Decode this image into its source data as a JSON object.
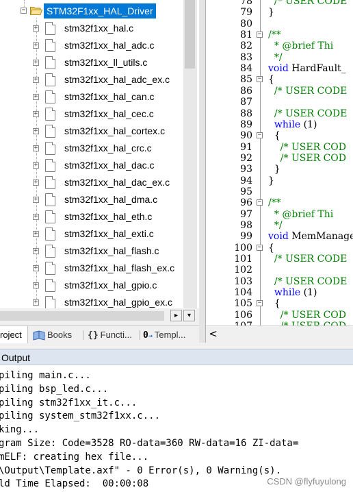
{
  "project_tree": {
    "folder": {
      "label": "STM32F1xx_HAL_Driver",
      "expander": "−"
    },
    "files": [
      "stm32f1xx_hal.c",
      "stm32f1xx_hal_adc.c",
      "stm32f1xx_ll_utils.c",
      "stm32f1xx_hal_adc_ex.c",
      "stm32f1xx_hal_can.c",
      "stm32f1xx_hal_cec.c",
      "stm32f1xx_hal_cortex.c",
      "stm32f1xx_hal_crc.c",
      "stm32f1xx_hal_dac.c",
      "stm32f1xx_hal_dac_ex.c",
      "stm32f1xx_hal_dma.c",
      "stm32f1xx_hal_eth.c",
      "stm32f1xx_hal_exti.c",
      "stm32f1xx_hal_flash.c",
      "stm32f1xx_hal_flash_ex.c",
      "stm32f1xx_hal_gpio.c",
      "stm32f1xx_hal_gpio_ex.c"
    ],
    "file_expander": "+",
    "scroll_right": "▸",
    "scroll_down": "▾"
  },
  "panel_tabs": [
    {
      "label": "roject",
      "icon": "project-icon",
      "active": true
    },
    {
      "label": "Books",
      "icon": "books-icon",
      "active": false
    },
    {
      "label": "Functi...",
      "icon": "braces-icon",
      "active": false
    },
    {
      "label": "Templ...",
      "icon": "template-icon",
      "active": false
    }
  ],
  "editor": {
    "lines": [
      {
        "n": "78",
        "fold": "",
        "tokens": [
          {
            "t": "  /* USER CODE",
            "c": "comment"
          }
        ]
      },
      {
        "n": "79",
        "fold": "",
        "tokens": [
          {
            "t": "}",
            "c": "plain"
          }
        ]
      },
      {
        "n": "80",
        "fold": "",
        "tokens": []
      },
      {
        "n": "81",
        "fold": "−",
        "tokens": [
          {
            "t": "/**",
            "c": "comment"
          }
        ]
      },
      {
        "n": "82",
        "fold": "",
        "tokens": [
          {
            "t": "  * @brief Thi",
            "c": "comment"
          }
        ]
      },
      {
        "n": "83",
        "fold": "",
        "tokens": [
          {
            "t": "  */",
            "c": "comment"
          }
        ]
      },
      {
        "n": "84",
        "fold": "",
        "tokens": [
          {
            "t": "void",
            "c": "keyword"
          },
          {
            "t": " HardFault_",
            "c": "plain"
          }
        ]
      },
      {
        "n": "85",
        "fold": "−",
        "tokens": [
          {
            "t": "{",
            "c": "plain"
          }
        ]
      },
      {
        "n": "86",
        "fold": "",
        "tokens": [
          {
            "t": "  /* USER CODE",
            "c": "comment"
          }
        ]
      },
      {
        "n": "87",
        "fold": "",
        "tokens": []
      },
      {
        "n": "88",
        "fold": "",
        "tokens": [
          {
            "t": "  /* USER CODE",
            "c": "comment"
          }
        ]
      },
      {
        "n": "89",
        "fold": "",
        "tokens": [
          {
            "t": "  while",
            "c": "keyword"
          },
          {
            "t": " (1)",
            "c": "plain"
          }
        ]
      },
      {
        "n": "90",
        "fold": "−",
        "tokens": [
          {
            "t": "  {",
            "c": "plain"
          }
        ]
      },
      {
        "n": "91",
        "fold": "",
        "tokens": [
          {
            "t": "    /* USER COD",
            "c": "comment"
          }
        ]
      },
      {
        "n": "92",
        "fold": "",
        "tokens": [
          {
            "t": "    /* USER COD",
            "c": "comment"
          }
        ]
      },
      {
        "n": "93",
        "fold": "",
        "tokens": [
          {
            "t": "  }",
            "c": "plain"
          }
        ]
      },
      {
        "n": "94",
        "fold": "",
        "tokens": [
          {
            "t": "}",
            "c": "plain"
          }
        ]
      },
      {
        "n": "95",
        "fold": "",
        "tokens": []
      },
      {
        "n": "96",
        "fold": "−",
        "tokens": [
          {
            "t": "/**",
            "c": "comment"
          }
        ]
      },
      {
        "n": "97",
        "fold": "",
        "tokens": [
          {
            "t": "  * @brief Thi",
            "c": "comment"
          }
        ]
      },
      {
        "n": "98",
        "fold": "",
        "tokens": [
          {
            "t": "  */",
            "c": "comment"
          }
        ]
      },
      {
        "n": "99",
        "fold": "",
        "tokens": [
          {
            "t": "void",
            "c": "keyword"
          },
          {
            "t": " MemManage_",
            "c": "plain"
          }
        ]
      },
      {
        "n": "100",
        "fold": "−",
        "tokens": [
          {
            "t": "{",
            "c": "plain"
          }
        ]
      },
      {
        "n": "101",
        "fold": "",
        "tokens": [
          {
            "t": "  /* USER CODE",
            "c": "comment"
          }
        ]
      },
      {
        "n": "102",
        "fold": "",
        "tokens": []
      },
      {
        "n": "103",
        "fold": "",
        "tokens": [
          {
            "t": "  /* USER CODE",
            "c": "comment"
          }
        ]
      },
      {
        "n": "104",
        "fold": "",
        "tokens": [
          {
            "t": "  while",
            "c": "keyword"
          },
          {
            "t": " (1)",
            "c": "plain"
          }
        ]
      },
      {
        "n": "105",
        "fold": "−",
        "tokens": [
          {
            "t": "  {",
            "c": "plain"
          }
        ]
      },
      {
        "n": "106",
        "fold": "",
        "tokens": [
          {
            "t": "    /* USER COD",
            "c": "comment"
          }
        ]
      },
      {
        "n": "107",
        "fold": "",
        "tokens": [
          {
            "t": "    /* USER COD",
            "c": "comment"
          }
        ]
      }
    ],
    "scroll_left": "<"
  },
  "output": {
    "title": "Output",
    "lines": [
      "piling main.c...",
      "piling bsp_led.c...",
      "piling stm32f1xx_it.c...",
      "piling system_stm32f1xx.c...",
      "king...",
      "gram Size: Code=3528 RO-data=360 RW-data=16 ZI-data=",
      "mELF: creating hex file...",
      "\\Output\\Template.axf\" - 0 Error(s), 0 Warning(s).",
      "ld Time Elapsed:  00:00:08"
    ],
    "watermark": "CSDN @flyfuyulong"
  },
  "colors": {
    "selection": "#0078d7",
    "comment": "#008000",
    "keyword": "#0000ff",
    "output_header": "#dde6f0"
  }
}
